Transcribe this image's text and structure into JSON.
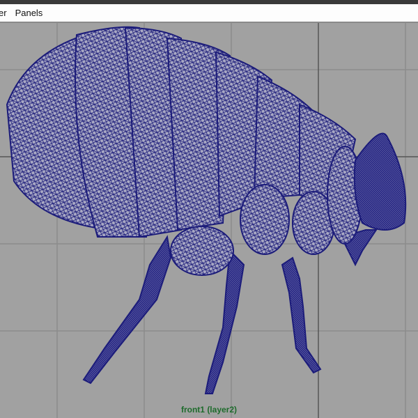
{
  "menubar": {
    "items": [
      {
        "label": "er"
      },
      {
        "label": "Panels"
      }
    ]
  },
  "viewport": {
    "camera_label": "front1 (layer2)",
    "background_color": "#a1a1a1",
    "grid_color": "#8c8c8c",
    "axis_color": "#444444",
    "wireframe_color": "#1c1c7a",
    "label_color": "#1e6b2c",
    "model": "flea wireframe mesh"
  }
}
